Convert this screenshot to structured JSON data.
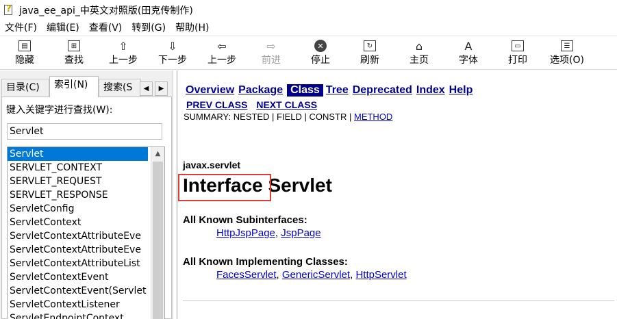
{
  "window": {
    "title": "java_ee_api_中英文对照版(田克传制作)",
    "icon": "help-file-icon"
  },
  "menu": [
    "文件(F)",
    "编辑(E)",
    "查看(V)",
    "转到(G)",
    "帮助(H)"
  ],
  "toolbar": {
    "hide": "隐藏",
    "find": "查找",
    "back": "上一步",
    "next_step": "下一步",
    "prev_step": "上一步",
    "forward": "前进",
    "stop": "停止",
    "refresh": "刷新",
    "home": "主页",
    "font": "字体",
    "print": "打印",
    "options": "选项(O)"
  },
  "left": {
    "tabs": {
      "contents": "目录(C)",
      "index": "索引(N)",
      "search": "搜索(S"
    },
    "keyword_label": "键入关键字进行查找(W):",
    "keyword_value": "Servlet",
    "items": [
      "Servlet",
      "SERVLET_CONTEXT",
      "SERVLET_REQUEST",
      "SERVLET_RESPONSE",
      "ServletConfig",
      "ServletContext",
      "ServletContextAttributeEve",
      "ServletContextAttributeEve",
      "ServletContextAttributeList",
      "ServletContextEvent",
      "ServletContextEvent(Servlet",
      "ServletContextListener",
      "ServletEndpointContext"
    ]
  },
  "doc": {
    "nav": {
      "overview": "Overview",
      "package": "Package",
      "class": "Class",
      "tree": "Tree",
      "deprecated": "Deprecated",
      "index": "Index",
      "help": "Help"
    },
    "prev_class": "PREV CLASS",
    "next_class": "NEXT CLASS",
    "summary_prefix": "SUMMARY: NESTED | FIELD | CONSTR | ",
    "summary_method": "METHOD",
    "package": "javax.servlet",
    "heading_kind": "Interface",
    "heading_name": "Servlet",
    "subinterfaces_title": "All Known Subinterfaces:",
    "subinterfaces": [
      "HttpJspPage",
      "JspPage"
    ],
    "impl_title": "All Known Implementing Classes:",
    "impl_classes": [
      "FacesServlet",
      "GenericServlet",
      "HttpServlet"
    ]
  },
  "colors": {
    "selection": "#0078d7",
    "nav_bg": "#00008b",
    "link": "#0000cc",
    "highlight": "#e03a3a"
  }
}
